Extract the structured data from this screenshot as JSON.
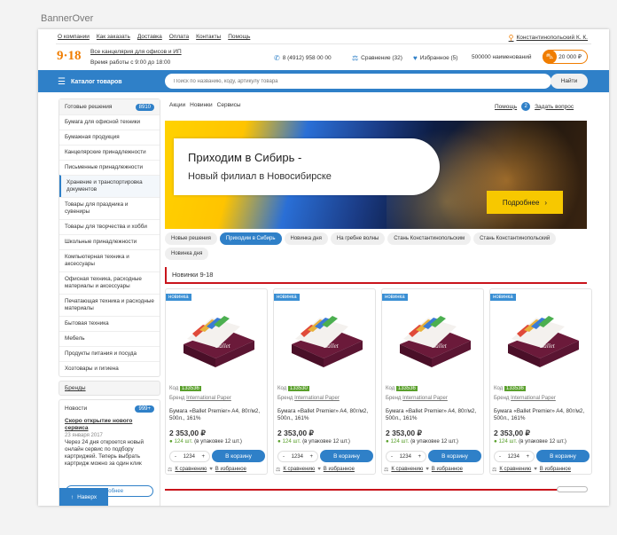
{
  "page_label": "BannerOver",
  "top_links": [
    "О компании",
    "Как заказать",
    "Доставка",
    "Оплата",
    "Контакты",
    "Помощь"
  ],
  "city": "Константинопольский К. К.",
  "logo": "9·18",
  "tagline": "Все канцелярия для офисов и ИП",
  "hours": "Время работы с 9:00 до 18:00",
  "phone": "8 (4912) 958 00 00",
  "compare": "Сравнение (32)",
  "favorites": "Избранное (5)",
  "item_count": "500000 наименований",
  "cart_total": "20 000 ₽",
  "catalog_label": "Каталог товаров",
  "search_placeholder": "Поиск по названию, коду, артикулу товара",
  "search_button": "Найти",
  "sidebar": {
    "ready": "Готовые решения",
    "ready_count": "8910",
    "items": [
      "Бумага для офисной техники",
      "Бумажная продукция",
      "Канцелярские принадлежности",
      "Письменные принадлежности",
      "Хранение и транспортировка документов",
      "Товары для праздника и сувениры",
      "Товары для творчества и хобби",
      "Школьные принадлежности",
      "Компьютерная техника и аксессуары",
      "Офисная техника, расходные материалы и аксессуары",
      "Печатающая техника и расходные материалы",
      "Бытовая техника",
      "Мебель",
      "Продукты питания и посуда",
      "Хозтовары и гигиена"
    ],
    "brands": "Бренды",
    "news_label": "Новости",
    "news_count": "999+",
    "news_title": "Скоро открытие нового сервиса",
    "news_date": "23 января 2017",
    "news_text": "Через 24 дня откроется новый онлайн сервис по подбору картриджей. Теперь выбрать картридж можно за один клик",
    "news_more": "Подробнее",
    "up_button": "Наверх"
  },
  "top_nav": [
    "Акции",
    "Новинки",
    "Сервисы"
  ],
  "help": "Помощь",
  "help_count": "2",
  "ask": "Задать вопрос",
  "hero": {
    "line1": "Приходим в Сибирь -",
    "line2": "Новый филиал в Новосибирске",
    "button": "Подробнее"
  },
  "chips": [
    "Новые решения",
    "Приходим в Сибирь",
    "Новинка дня",
    "На гребне волны",
    "Стань Константинопольским",
    "Стань Константинопольский",
    "Новинка дня"
  ],
  "active_chip_index": 1,
  "section_title": "Новинки 9-18",
  "products": [
    {
      "tag": "новинка",
      "code_label": "Код",
      "code": "133536",
      "brand_label": "Бренд",
      "brand": "International Paper",
      "name": "Бумага «Ballet Premier» A4, 80г/м2, 500л., 161%",
      "price": "2 353,00 ₽",
      "stock": "124 шт.",
      "pack": "(в упаковке 12 шт.)",
      "qty": "1234",
      "buy": "В корзину",
      "compare": "К сравнению",
      "fav": "В избранное"
    },
    {
      "tag": "новинка",
      "code_label": "Код",
      "code": "133530",
      "brand_label": "Бренд",
      "brand": "International Paper",
      "name": "Бумага «Ballet Premier» A4, 80г/м2, 500л., 161%",
      "price": "2 353,00 ₽",
      "stock": "124 шт.",
      "pack": "(в упаковке 12 шт.)",
      "qty": "1234",
      "buy": "В корзину",
      "compare": "К сравнению",
      "fav": "В избранное"
    },
    {
      "tag": "новинка",
      "code_label": "Код",
      "code": "133536",
      "brand_label": "Бренд",
      "brand": "International Paper",
      "name": "Бумага «Ballet Premier» A4, 80г/м2, 500л., 161%",
      "price": "2 353,00 ₽",
      "stock": "124 шт.",
      "pack": "(в упаковке 12 шт.)",
      "qty": "1234",
      "buy": "В корзину",
      "compare": "К сравнению",
      "fav": "В избранное"
    },
    {
      "tag": "новинка",
      "code_label": "Код",
      "code": "133536",
      "brand_label": "Бренд",
      "brand": "International Paper",
      "name": "Бумага «Ballet Premier» A4, 80г/м2, 500л., 161%",
      "price": "2 353,00 ₽",
      "stock": "124 шт.",
      "pack": "(в упаковке 12 шт.)",
      "qty": "1234",
      "buy": "В корзину",
      "compare": "К сравнению",
      "fav": "В избранное"
    }
  ],
  "colors": {
    "accent": "#2f80c8",
    "brand": "#f07d00",
    "in_stock": "#5aa02c",
    "section_line": "#c9141b"
  }
}
